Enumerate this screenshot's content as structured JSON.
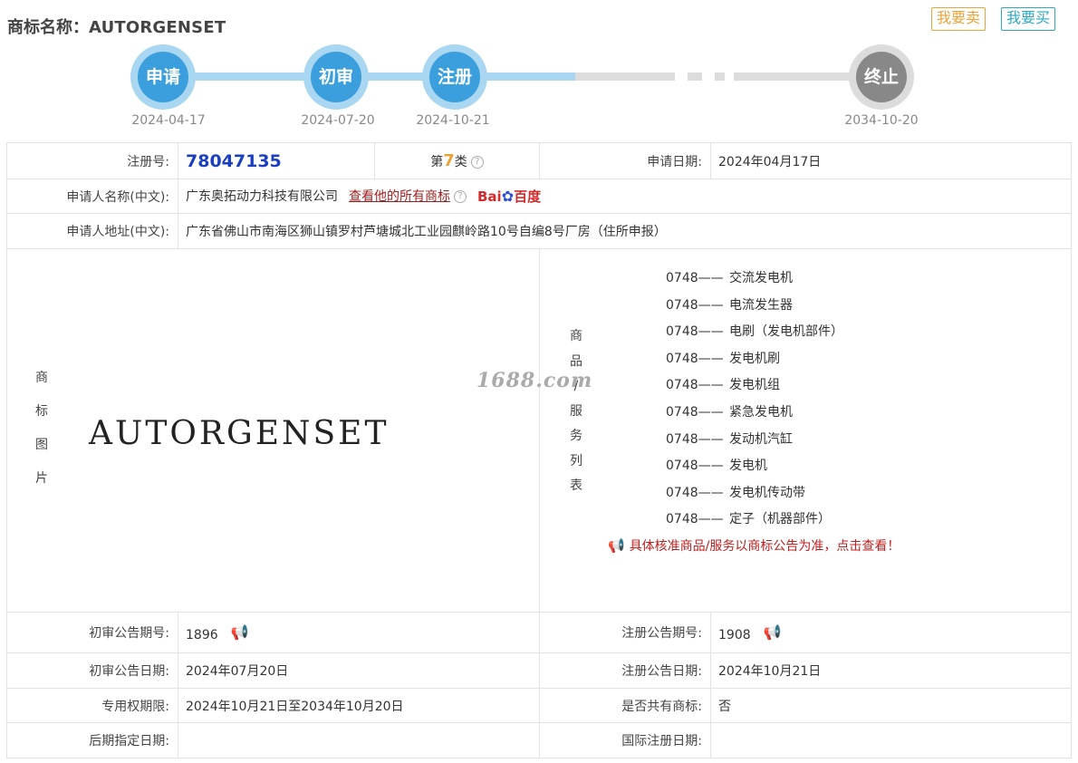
{
  "header": {
    "title_prefix": "商标名称：",
    "title_name": "AUTORGENSET",
    "sell_label": "我要卖",
    "buy_label": "我要买"
  },
  "timeline": {
    "steps": [
      {
        "label": "申请",
        "date": "2024-04-17"
      },
      {
        "label": "初审",
        "date": "2024-07-20"
      },
      {
        "label": "注册",
        "date": "2024-10-21"
      },
      {
        "label": "终止",
        "date": "2034-10-20"
      }
    ]
  },
  "info": {
    "reg_no_label": "注册号:",
    "reg_no": "78047135",
    "class_prefix": "第",
    "class_num": "7",
    "class_suffix": "类",
    "apply_date_label": "申请日期:",
    "apply_date": "2024年04月17日",
    "applicant_label": "申请人名称(中文):",
    "applicant": "广东奥拓动力科技有限公司",
    "view_all_link": "查看他的所有商标",
    "baidu_text": "Bai",
    "baidu_cn": "百度",
    "address_label": "申请人地址(中文):",
    "address": "广东省佛山市南海区狮山镇罗村芦塘城北工业园麒岭路10号自编8号厂房（住所申报）"
  },
  "mark": {
    "label_chars": [
      "商",
      "标",
      "图",
      "片"
    ],
    "image_text": "AUTORGENSET",
    "watermark": "1688.com"
  },
  "goods": {
    "label_chars": [
      "商",
      "品",
      "/",
      "服",
      "务",
      "列",
      "表"
    ],
    "items": [
      {
        "code": "0748——",
        "name": "交流发电机"
      },
      {
        "code": "0748——",
        "name": "电流发生器"
      },
      {
        "code": "0748——",
        "name": "电刷（发电机部件）"
      },
      {
        "code": "0748——",
        "name": "发电机刷"
      },
      {
        "code": "0748——",
        "name": "发电机组"
      },
      {
        "code": "0748——",
        "name": "紧急发电机"
      },
      {
        "code": "0748——",
        "name": "发动机汽缸"
      },
      {
        "code": "0748——",
        "name": "发电机"
      },
      {
        "code": "0748——",
        "name": "发电机传动带"
      },
      {
        "code": "0748——",
        "name": "定子（机器部件）"
      }
    ],
    "note": "具体核准商品/服务以商标公告为准，点击查看！"
  },
  "details": {
    "prelim_no_label": "初审公告期号:",
    "prelim_no": "1896",
    "reg_pub_no_label": "注册公告期号:",
    "reg_pub_no": "1908",
    "prelim_date_label": "初审公告日期:",
    "prelim_date": "2024年07月20日",
    "reg_pub_date_label": "注册公告日期:",
    "reg_pub_date": "2024年10月21日",
    "term_label": "专用权期限:",
    "term": "2024年10月21日至2034年10月20日",
    "shared_label": "是否共有商标:",
    "shared": "否",
    "later_date_label": "后期指定日期:",
    "later_date": "",
    "intl_date_label": "国际注册日期:",
    "intl_date": ""
  }
}
